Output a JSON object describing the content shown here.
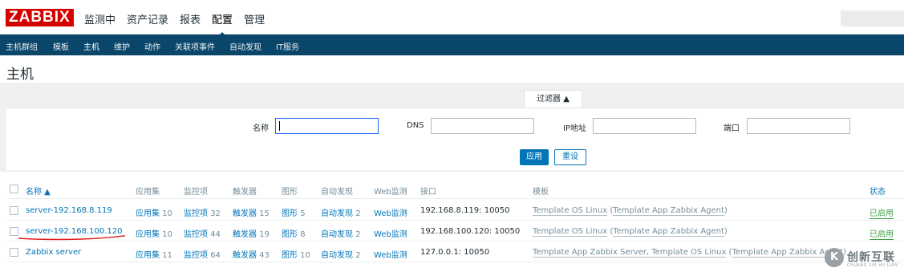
{
  "header": {
    "logo": "ZABBIX",
    "menu": [
      "监测中",
      "资产记录",
      "报表",
      "配置",
      "管理"
    ],
    "active_menu": "配置"
  },
  "subnav": [
    "主机群组",
    "模板",
    "主机",
    "维护",
    "动作",
    "关联项事件",
    "自动发现",
    "IT服务"
  ],
  "page_title": "主机",
  "filter": {
    "tab_label": "过滤器 ▲",
    "name_label": "名称",
    "name_value": "",
    "dns_label": "DNS",
    "dns_value": "",
    "ip_label": "IP地址",
    "ip_value": "",
    "port_label": "端口",
    "port_value": "",
    "apply_label": "应用",
    "reset_label": "重设"
  },
  "table": {
    "headers": {
      "name": "名称 ▲",
      "applications": "应用集",
      "items": "监控项",
      "triggers": "触发器",
      "graphs": "图形",
      "discovery": "自动发现",
      "web": "Web监测",
      "interface": "接口",
      "templates": "模板",
      "status": "状态"
    },
    "rows": [
      {
        "name": "server-192.168.8.119",
        "app_label": "应用集",
        "app_count": "10",
        "items_label": "监控项",
        "items_count": "32",
        "triggers_label": "触发器",
        "triggers_count": "15",
        "graphs_label": "图形",
        "graphs_count": "5",
        "discovery_label": "自动发现",
        "discovery_count": "2",
        "web": "Web监测",
        "interface": "192.168.8.119: 10050",
        "tpl_main": "Template OS Linux",
        "tpl_sub": "Template App Zabbix Agent",
        "status": "已启用"
      },
      {
        "name": "server-192.168.100.120",
        "app_label": "应用集",
        "app_count": "10",
        "items_label": "监控项",
        "items_count": "44",
        "triggers_label": "触发器",
        "triggers_count": "19",
        "graphs_label": "图形",
        "graphs_count": "8",
        "discovery_label": "自动发现",
        "discovery_count": "2",
        "web": "Web监测",
        "interface": "192.168.100.120: 10050",
        "tpl_main": "Template OS Linux",
        "tpl_sub": "Template App Zabbix Agent",
        "status": "已启用"
      },
      {
        "name": "Zabbix server",
        "app_label": "应用集",
        "app_count": "11",
        "items_label": "监控项",
        "items_count": "64",
        "triggers_label": "触发器",
        "triggers_count": "43",
        "graphs_label": "图形",
        "graphs_count": "10",
        "discovery_label": "自动发现",
        "discovery_count": "2",
        "web": "Web监测",
        "interface": "127.0.0.1: 10050",
        "tpl_main": "Template App Zabbix Server, Template OS Linux",
        "tpl_sub": "Template App Zabbix Agent",
        "status": ""
      }
    ]
  },
  "watermark": {
    "symbol": "K",
    "text": "创新互联",
    "sub": "CHUANG XIN HU LIAN"
  },
  "colors": {
    "brand_red": "#d40000",
    "nav_blue": "#0a466a",
    "link_blue": "#0275b8",
    "status_green": "#429e47",
    "annotation_red": "#e0201d"
  }
}
